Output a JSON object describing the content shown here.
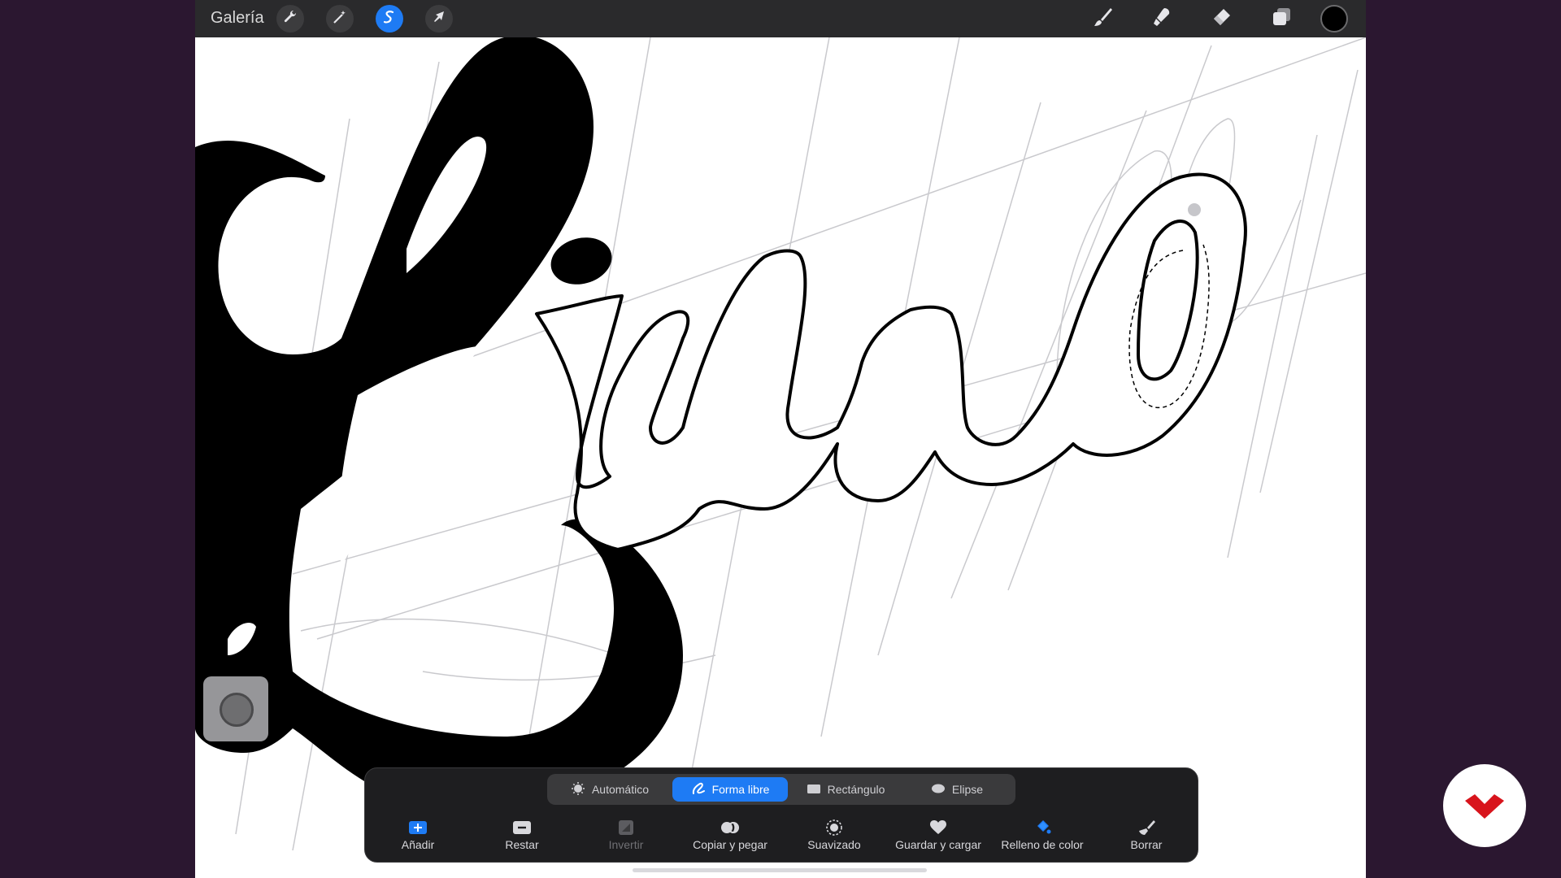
{
  "topbar": {
    "gallery_label": "Galería",
    "tools_left": [
      {
        "name": "wrench-icon"
      },
      {
        "name": "magic-wand-icon"
      },
      {
        "name": "selection-icon"
      },
      {
        "name": "transform-arrow-icon"
      }
    ],
    "tools_right": [
      {
        "name": "brush-icon"
      },
      {
        "name": "smudge-icon"
      },
      {
        "name": "eraser-icon"
      },
      {
        "name": "layers-icon"
      }
    ],
    "current_color": "#000000",
    "active_tool": "selection-icon"
  },
  "selection_panel": {
    "modes": [
      {
        "label": "Automático",
        "icon": "auto-select-icon",
        "active": false
      },
      {
        "label": "Forma libre",
        "icon": "freehand-icon",
        "active": true
      },
      {
        "label": "Rectángulo",
        "icon": "rectangle-icon",
        "active": false
      },
      {
        "label": "Elipse",
        "icon": "ellipse-icon",
        "active": false
      }
    ],
    "actions": [
      {
        "label": "Añadir",
        "icon": "add-icon",
        "enabled": true
      },
      {
        "label": "Restar",
        "icon": "subtract-icon",
        "enabled": true
      },
      {
        "label": "Invertir",
        "icon": "invert-icon",
        "enabled": false
      },
      {
        "label": "Copiar y pegar",
        "icon": "copy-paste-icon",
        "enabled": true
      },
      {
        "label": "Suavizado",
        "icon": "feather-icon",
        "enabled": true
      },
      {
        "label": "Guardar y cargar",
        "icon": "heart-icon",
        "enabled": true
      },
      {
        "label": "Relleno de color",
        "icon": "color-fill-icon",
        "enabled": true
      },
      {
        "label": "Borrar",
        "icon": "clear-brush-icon",
        "enabled": true
      }
    ]
  },
  "colors": {
    "accent": "#1e7bf4",
    "topbar_bg": "#2a2a2c",
    "panel_bg": "#1e1e20",
    "outer_bg": "#2b1730",
    "brand": "#d8141c"
  }
}
